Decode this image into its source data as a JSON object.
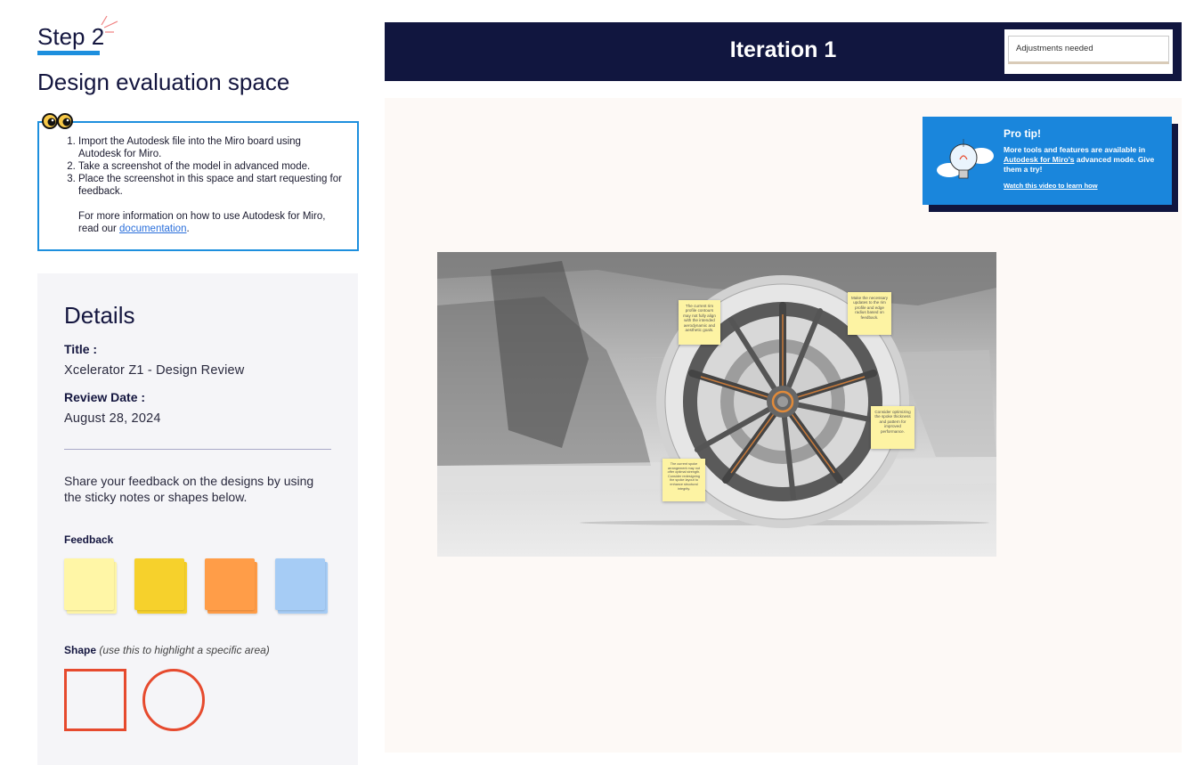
{
  "step": {
    "title": "Step 2",
    "subtitle": "Design evaluation space"
  },
  "instructions": {
    "items": [
      "Import the Autodesk file into the Miro board using Autodesk for Miro.",
      "Take a screenshot of the model in advanced mode.",
      "Place the screenshot in this space and start requesting for feedback."
    ],
    "more_text": "For more information on how to use Autodesk for Miro, read our ",
    "link_text": "documentation",
    "period": "."
  },
  "details": {
    "heading": "Details",
    "title_label": "Title :",
    "title_value": "Xcelerator Z1 - Design Review",
    "date_label": "Review Date :",
    "date_value": "August 28, 2024",
    "share_text": "Share your feedback on the designs by using the sticky notes or shapes below.",
    "feedback_label": "Feedback",
    "shape_label": "Shape",
    "shape_hint": "(use this to highlight a specific area)"
  },
  "sticky_colors": [
    "#fff6a6",
    "#f6d12c",
    "#ff9d48",
    "#a6ccf5"
  ],
  "accent": "#e64a2e",
  "header": {
    "title": "Iteration 1",
    "status": "Adjustments needed"
  },
  "protip": {
    "title": "Pro tip!",
    "body_pre": "More tools and features are available in ",
    "body_link": "Autodesk for Miro's",
    "body_post": " advanced mode. Give them a try!",
    "link": "Watch this video to learn how"
  },
  "notes": {
    "n1": "The current rim profile contours may not fully align with the intended aerodynamic and aesthetic goals.",
    "n2": "Make the necessary updates to the rim profile and edge radius based on feedback.",
    "n3": "Consider optimizing the spoke thickness and pattern for improved performance.",
    "n4": "The current spoke arrangement may not offer optimal strength. Consider redesigning the spoke layout to enhance structural integrity."
  }
}
